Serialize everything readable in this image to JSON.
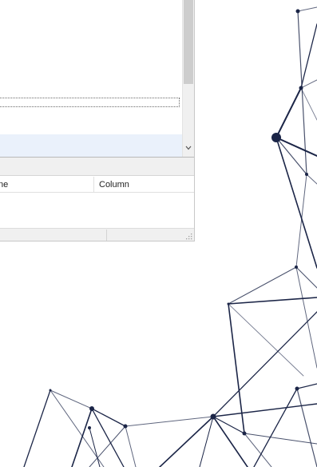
{
  "error_list": {
    "columns": [
      "ne",
      "Column"
    ]
  },
  "icons": {
    "scroll_down": "chevron-down-icon",
    "resize": "resize-grip-icon"
  },
  "colors": {
    "network_lines": "#1b2547",
    "selection": "#eaf1fb",
    "chrome": "#f0f0f0"
  }
}
